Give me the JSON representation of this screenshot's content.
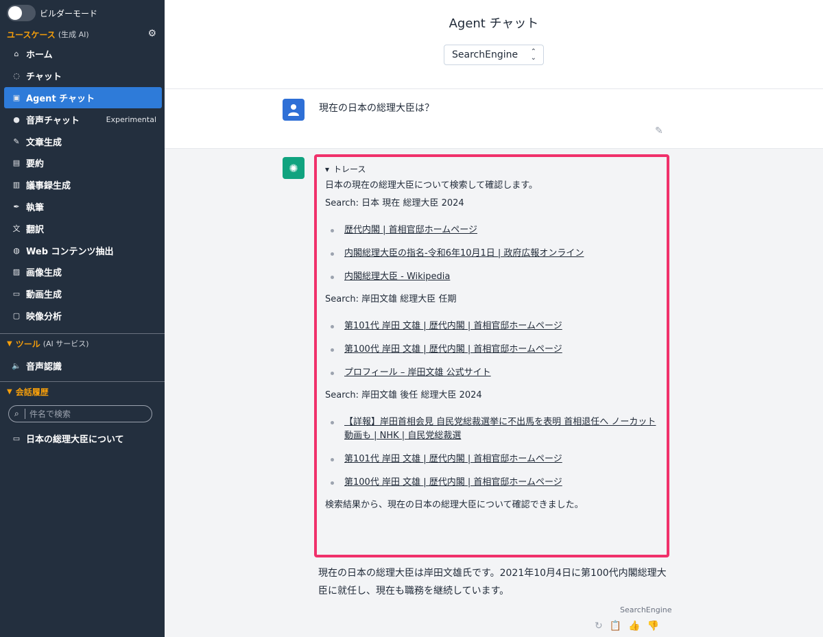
{
  "sidebar": {
    "builder_mode_label": "ビルダーモード",
    "usecase_section": {
      "label": "ユースケース",
      "sublabel": "(生成 AI)"
    },
    "items": [
      {
        "label": "ホーム",
        "icon": "home-icon"
      },
      {
        "label": "チャット",
        "icon": "chat-icon"
      },
      {
        "label": "Agent チャット",
        "icon": "agent-icon",
        "active": true
      },
      {
        "label": "音声チャット",
        "icon": "mic-icon",
        "extra": "Experimental"
      },
      {
        "label": "文章生成",
        "icon": "pencil-icon"
      },
      {
        "label": "要約",
        "icon": "summary-icon"
      },
      {
        "label": "議事録生成",
        "icon": "minutes-icon"
      },
      {
        "label": "執筆",
        "icon": "pen-icon"
      },
      {
        "label": "翻訳",
        "icon": "translate-icon"
      },
      {
        "label": "Web コンテンツ抽出",
        "icon": "globe-icon"
      },
      {
        "label": "画像生成",
        "icon": "image-icon"
      },
      {
        "label": "動画生成",
        "icon": "video-icon"
      },
      {
        "label": "映像分析",
        "icon": "camera-icon"
      }
    ],
    "tools_section": {
      "label": "ツール",
      "sublabel": "(AI サービス)"
    },
    "tools": [
      {
        "label": "音声認識",
        "icon": "speaker-icon"
      }
    ],
    "history_section": {
      "label": "会話履歴"
    },
    "search_placeholder": "件名で検索",
    "history": [
      {
        "label": "日本の総理大臣について"
      }
    ]
  },
  "main": {
    "title": "Agent チャット",
    "agent_select": "SearchEngine",
    "user_message": "現在の日本の総理大臣は？",
    "trace": {
      "summary": "トレース",
      "intro": "日本の現在の総理大臣について検索して確認します。",
      "searches": [
        {
          "query": "Search: 日本 現在 総理大臣 2024",
          "results": [
            "歴代内閣 | 首相官邸ホームページ",
            "内閣総理大臣の指名-令和6年10月1日 | 政府広報オンライン",
            "内閣総理大臣 - Wikipedia"
          ]
        },
        {
          "query": "Search: 岸田文雄 総理大臣 任期",
          "results": [
            "第101代 岸田 文雄 | 歴代内閣 | 首相官邸ホームページ",
            "第100代 岸田 文雄 | 歴代内閣 | 首相官邸ホームページ",
            "プロフィール – 岸田文雄 公式サイト"
          ]
        },
        {
          "query": "Search: 岸田文雄 後任 総理大臣 2024",
          "results": [
            "【詳報】岸田首相会見 自民党総裁選挙に不出馬を表明 首相退任へ ノーカット動画も | NHK | 自民党総裁選",
            "第101代 岸田 文雄 | 歴代内閣 | 首相官邸ホームページ",
            "第100代 岸田 文雄 | 歴代内閣 | 首相官邸ホームページ"
          ]
        }
      ],
      "conclusion": "検索結果から、現在の日本の総理大臣について確認できました。"
    },
    "answer": "現在の日本の総理大臣は岸田文雄氏です。2021年10月4日に第100代内閣総理大臣に就任し、現在も職務を継続しています。",
    "answer_engine": "SearchEngine",
    "highlight_color": "#f0316b"
  }
}
